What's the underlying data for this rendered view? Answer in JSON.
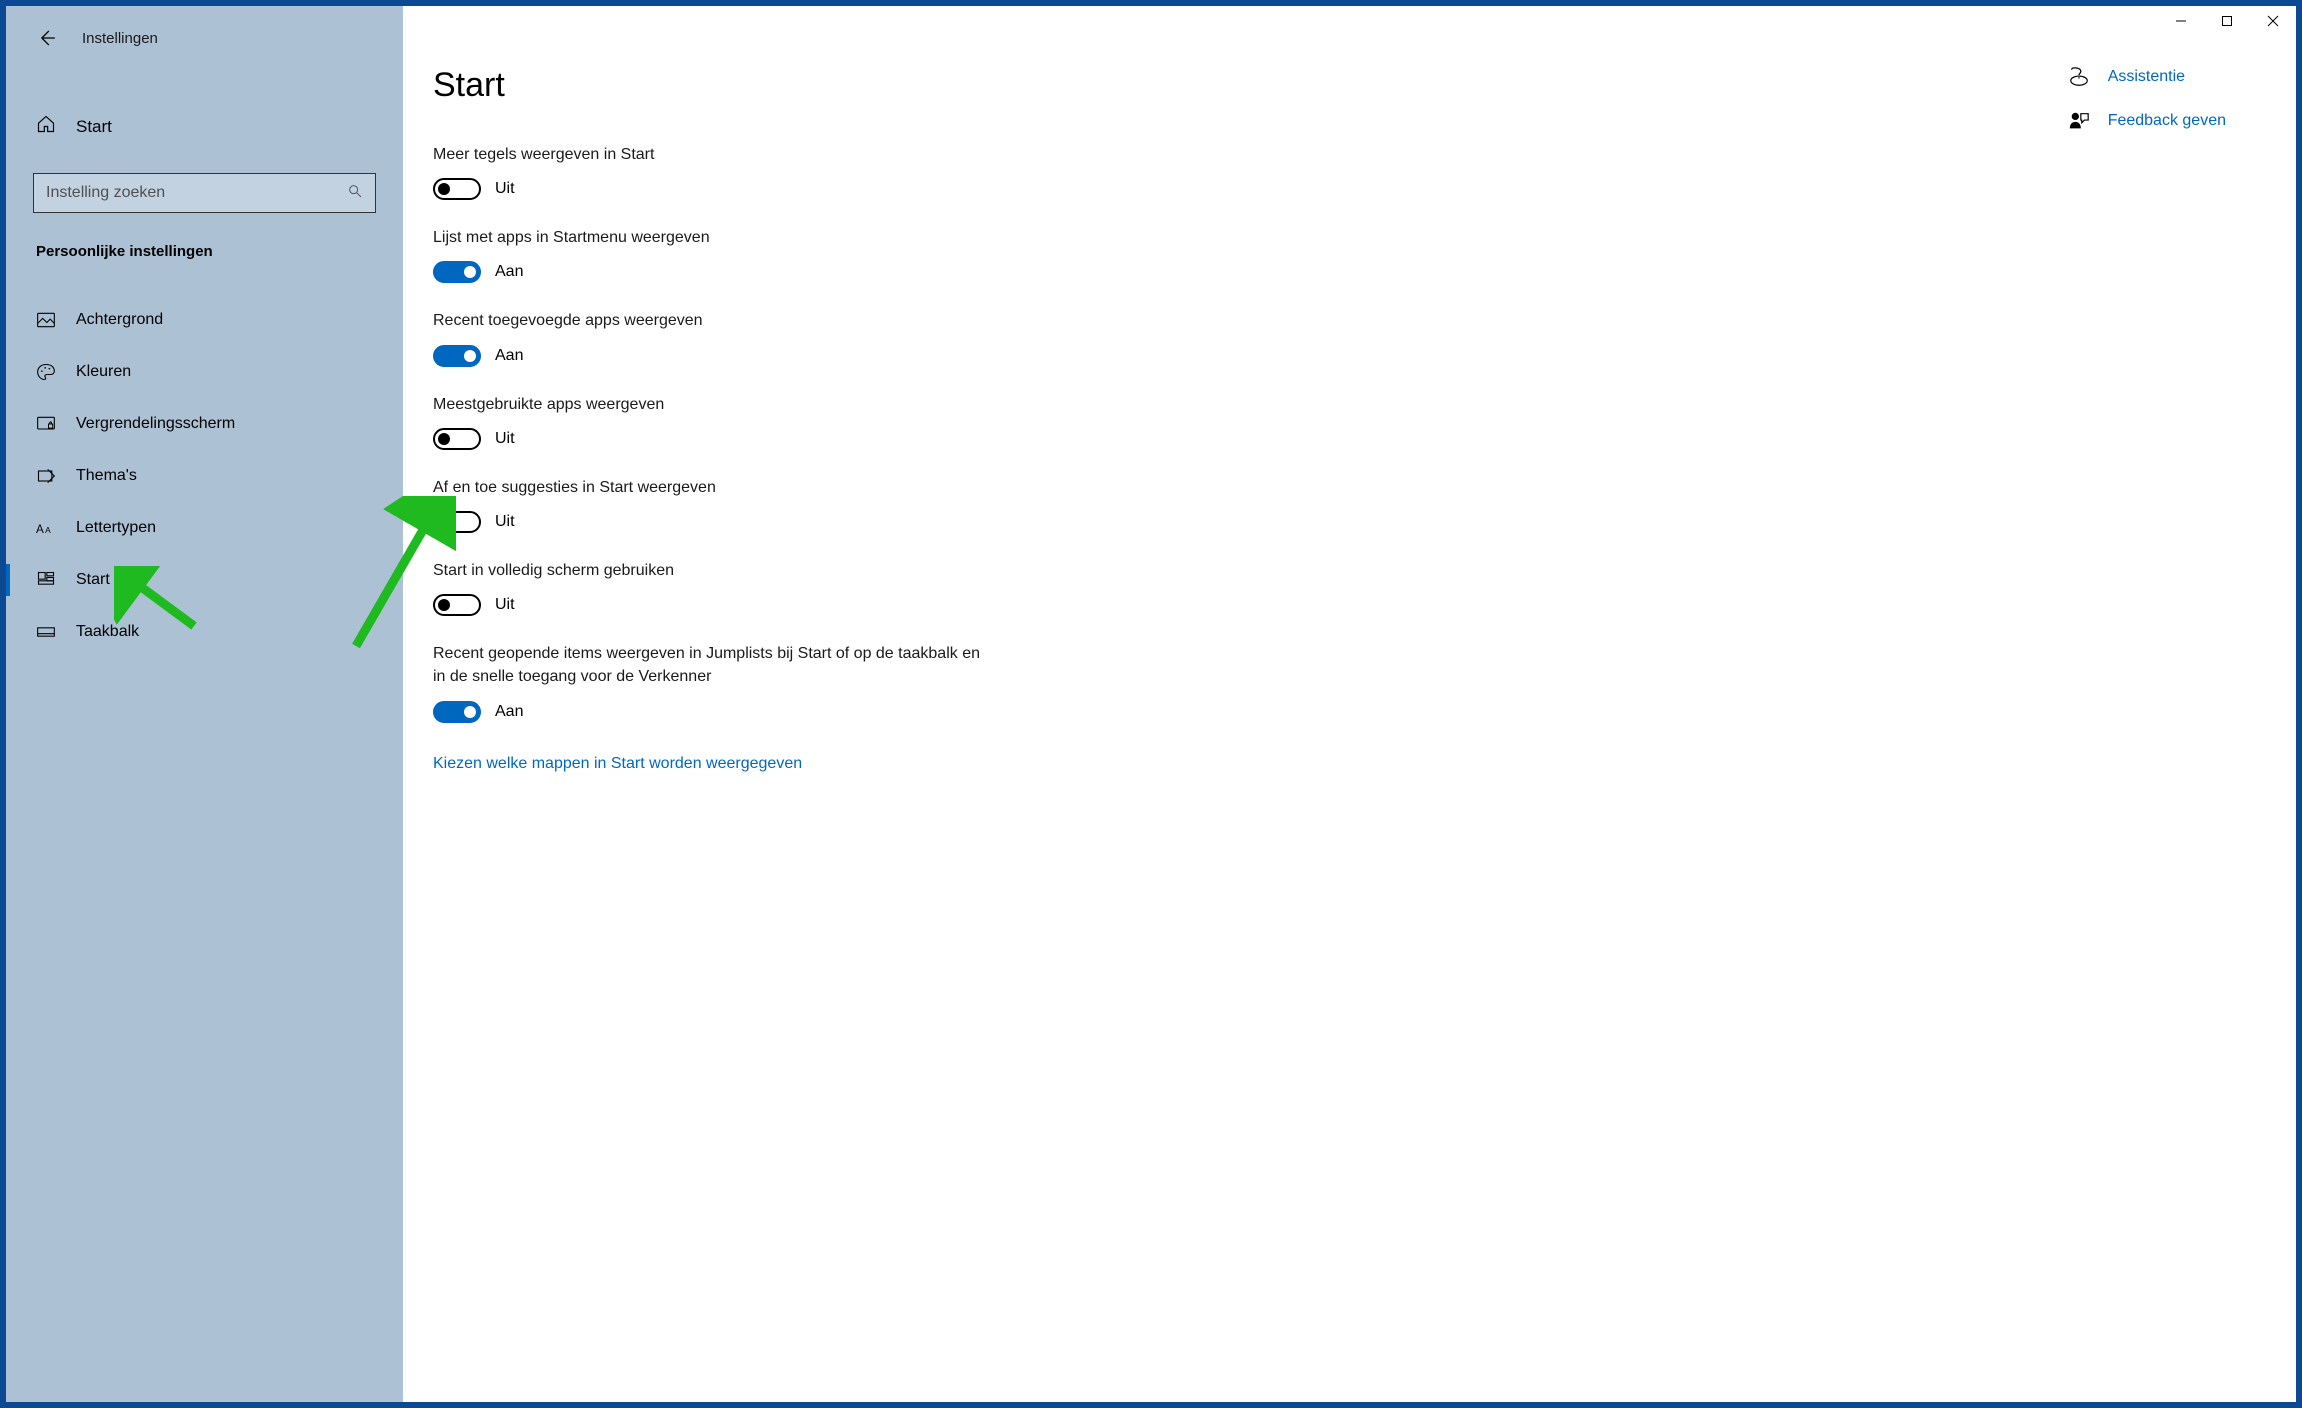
{
  "window": {
    "title": "Instellingen",
    "home_label": "Start",
    "search_placeholder": "Instelling zoeken",
    "category": "Persoonlijke instellingen"
  },
  "nav": {
    "items": [
      {
        "label": "Achtergrond",
        "icon": "image-icon",
        "active": false
      },
      {
        "label": "Kleuren",
        "icon": "palette-icon",
        "active": false
      },
      {
        "label": "Vergrendelingsscherm",
        "icon": "lock-screen-icon",
        "active": false
      },
      {
        "label": "Thema's",
        "icon": "theme-icon",
        "active": false
      },
      {
        "label": "Lettertypen",
        "icon": "font-icon",
        "active": false
      },
      {
        "label": "Start",
        "icon": "start-icon",
        "active": true
      },
      {
        "label": "Taakbalk",
        "icon": "taskbar-icon",
        "active": false
      }
    ]
  },
  "page": {
    "title": "Start",
    "settings": [
      {
        "label": "Meer tegels weergeven in Start",
        "on": false
      },
      {
        "label": "Lijst met apps in Startmenu weergeven",
        "on": true
      },
      {
        "label": "Recent toegevoegde apps weergeven",
        "on": true
      },
      {
        "label": "Meestgebruikte apps weergeven",
        "on": false
      },
      {
        "label": "Af en toe suggesties in Start weergeven",
        "on": false
      },
      {
        "label": "Start in volledig scherm gebruiken",
        "on": false
      },
      {
        "label": "Recent geopende items weergeven in Jumplists bij Start of op de taakbalk en in de snelle toegang voor de Verkenner",
        "on": true
      }
    ],
    "toggle_on_text": "Aan",
    "toggle_off_text": "Uit",
    "folders_link": "Kiezen welke mappen in Start worden weergegeven"
  },
  "aside": {
    "items": [
      {
        "label": "Assistentie",
        "icon": "help-icon"
      },
      {
        "label": "Feedback geven",
        "icon": "feedback-icon"
      }
    ]
  }
}
